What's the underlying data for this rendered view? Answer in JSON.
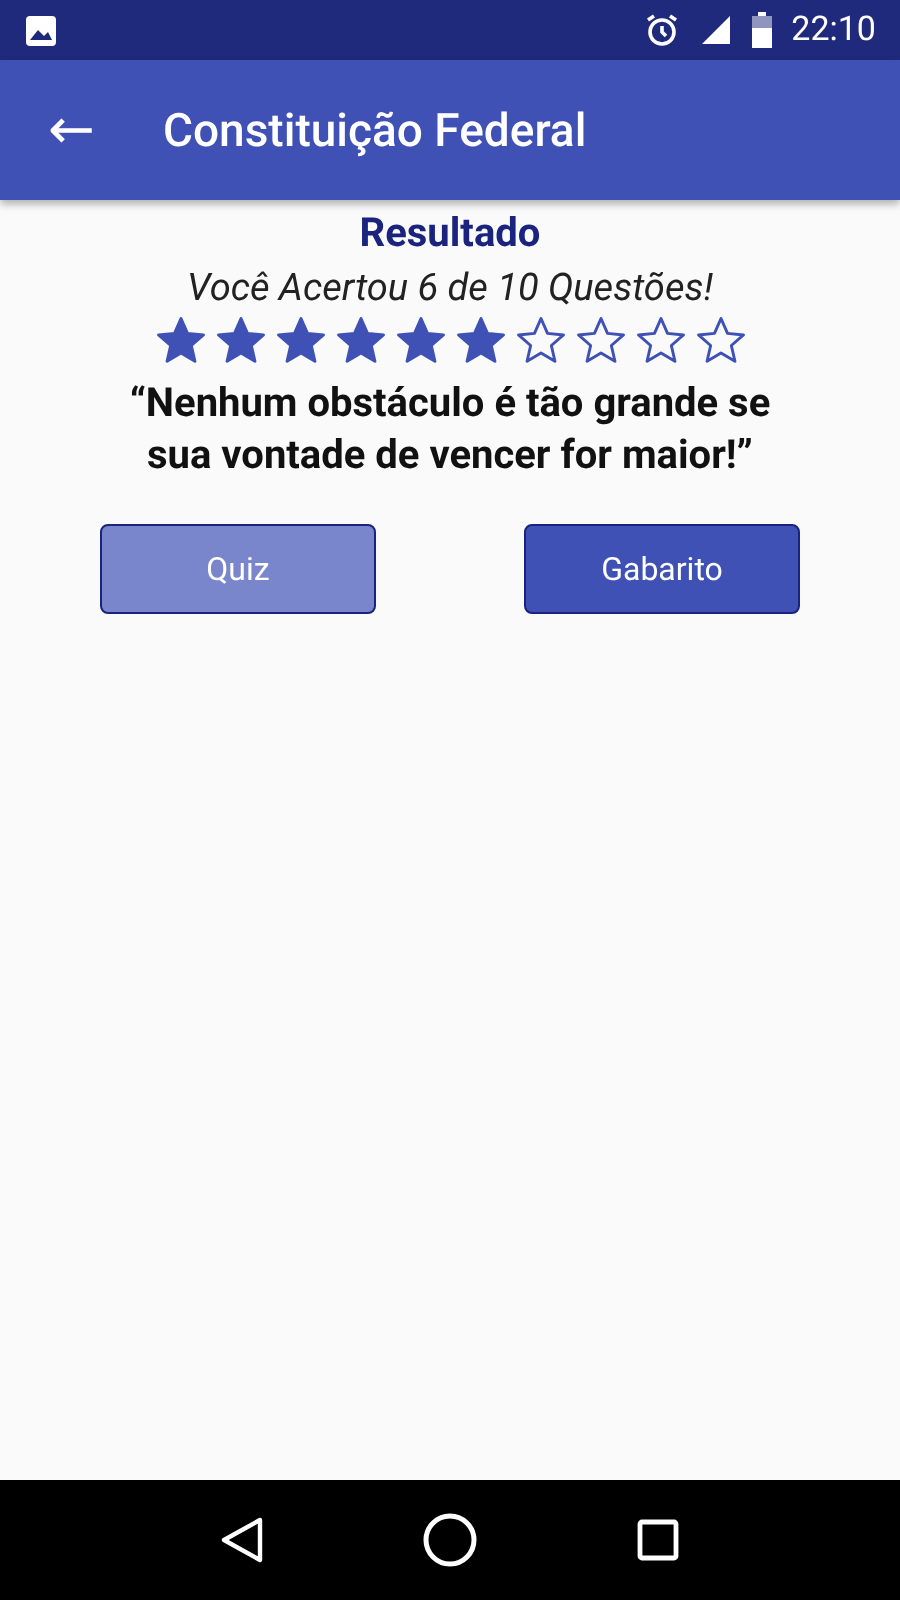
{
  "status_bar": {
    "time": "22:10"
  },
  "app_bar": {
    "back": "←",
    "title": "Constituição Federal"
  },
  "result": {
    "heading": "Resultado",
    "score_text": "Você Acertou 6 de 10 Questões!",
    "stars": 6,
    "quote": "“Nenhum obstáculo é tão grande se sua vontade de vencer for maior!”"
  },
  "buttons": [
    {
      "label": "Quiz",
      "disabled": true
    },
    {
      "label": "Gabarito",
      "disabled": false
    }
  ]
}
